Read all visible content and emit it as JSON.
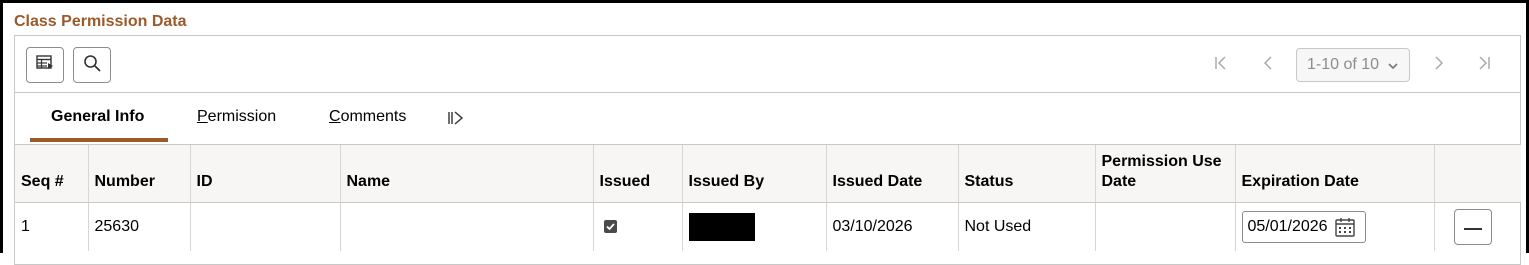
{
  "section": {
    "title": "Class Permission Data"
  },
  "toolbar": {
    "view_options_icon": "table-settings-icon",
    "search_icon": "search-icon"
  },
  "pager": {
    "range": "1-10 of 10",
    "first_icon": "first-page-icon",
    "prev_icon": "previous-page-icon",
    "next_icon": "next-page-icon",
    "last_icon": "last-page-icon"
  },
  "tabs": [
    {
      "label": "General Info",
      "active": true
    },
    {
      "label": "Permission",
      "active": false
    },
    {
      "label": "Comments",
      "active": false
    }
  ],
  "table": {
    "columns": [
      "Seq #",
      "Number",
      "ID",
      "Name",
      "Issued",
      "Issued By",
      "Issued Date",
      "Status",
      "Permission Use Date",
      "Expiration Date",
      ""
    ],
    "rows": [
      {
        "seq": "1",
        "number": "25630",
        "id": "",
        "name": "",
        "issued": true,
        "issued_by": "",
        "issued_date": "03/10/2026",
        "status": "Not Used",
        "permission_use_date": "",
        "expiration_date": "05/01/2026"
      }
    ]
  },
  "colors": {
    "accent": "#9a5a2a",
    "header_bg": "#f7f6f4",
    "border": "#c8c8c8"
  }
}
